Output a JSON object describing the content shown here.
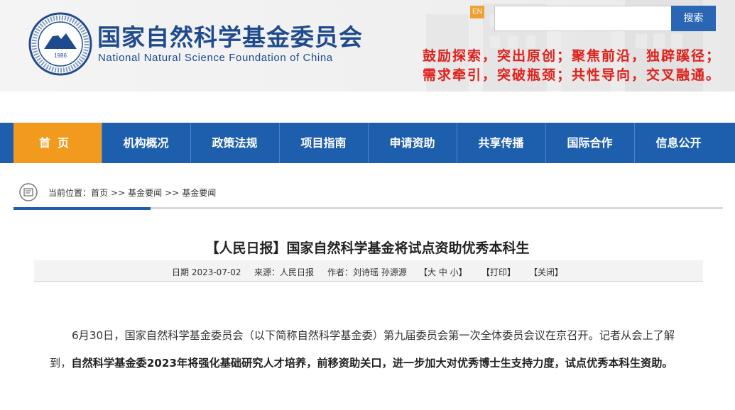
{
  "header": {
    "seal_year": "1986",
    "org_name_cn": "国家自然科学基金委员会",
    "org_name_en": "National Natural Science Foundation of China",
    "en_link": "EN",
    "search_placeholder": "",
    "search_button": "搜索",
    "slogan_line1": "鼓励探索，突出原创；聚焦前沿，独辟蹊径；",
    "slogan_line2": "需求牵引，突破瓶颈；共性导向，交叉融通。"
  },
  "nav": {
    "items": [
      "首页",
      "机构概况",
      "政策法规",
      "项目指南",
      "申请资助",
      "共享传播",
      "国际合作",
      "信息公开"
    ],
    "active_index": 0
  },
  "breadcrumb": {
    "label": "当前位置：",
    "items": [
      "首页",
      "基金要闻",
      "基金要闻"
    ],
    "separator": ">>"
  },
  "article": {
    "title": "【人民日报】国家自然科学基金将试点资助优秀本科生",
    "date": "日期 2023-07-02",
    "source": "来源：人民日报",
    "author": "作者：刘诗瑶 孙源源",
    "font_size_label": "【大 中 小】",
    "print_label": "【打印】",
    "close_label": "【关闭】",
    "para_normal": "6月30日，国家自然科学基金委员会（以下简称自然科学基金委）第九届委员会第一次全体委员会议在京召开。记者从会上了解到，",
    "para_bold": "自然科学基金委2023年将强化基础研究人才培养，前移资助关口，进一步加大对优秀博士生支持力度，试点优秀本科生资助。"
  },
  "colors": {
    "nav_blue": "#1e5fad",
    "nav_active": "#f29a1e",
    "slogan_red": "#e0201b",
    "title_blue": "#1f4b8e"
  }
}
